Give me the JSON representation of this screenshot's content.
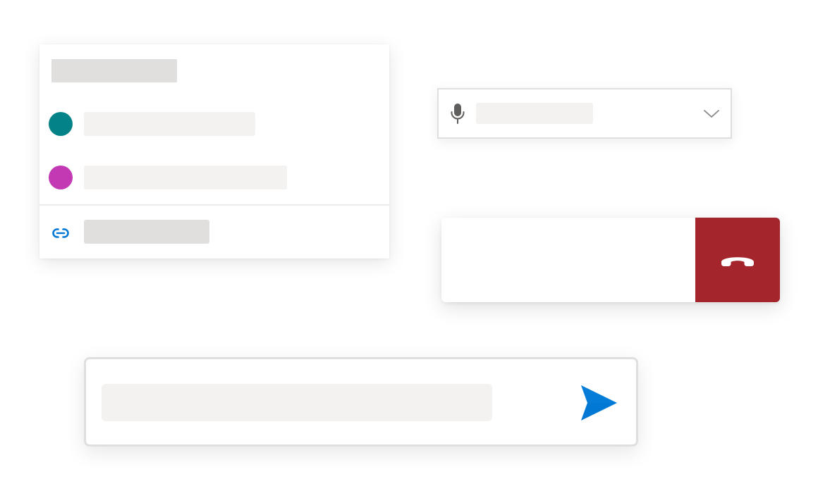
{
  "colors": {
    "placeholder_dark": "#e1dfdd",
    "placeholder_light": "#f3f2f1",
    "avatar_teal": "#038387",
    "avatar_magenta": "#c239b3",
    "link_blue": "#0078d4",
    "icon_gray": "#605e5c",
    "hangup_red": "#a4262c",
    "send_blue": "#0078d4"
  },
  "participants_card": {
    "title": "",
    "items": [
      {
        "name": "",
        "avatar_color": "#038387"
      },
      {
        "name": "",
        "avatar_color": "#c239b3"
      }
    ],
    "link": {
      "icon": "link-icon",
      "label": ""
    }
  },
  "mic_dropdown": {
    "icon": "microphone-icon",
    "selected_value": "",
    "chevron": "chevron-down-icon"
  },
  "call_controls": {
    "hangup_icon": "phone-hangup-icon"
  },
  "compose": {
    "placeholder": "",
    "send_icon": "send-icon"
  }
}
